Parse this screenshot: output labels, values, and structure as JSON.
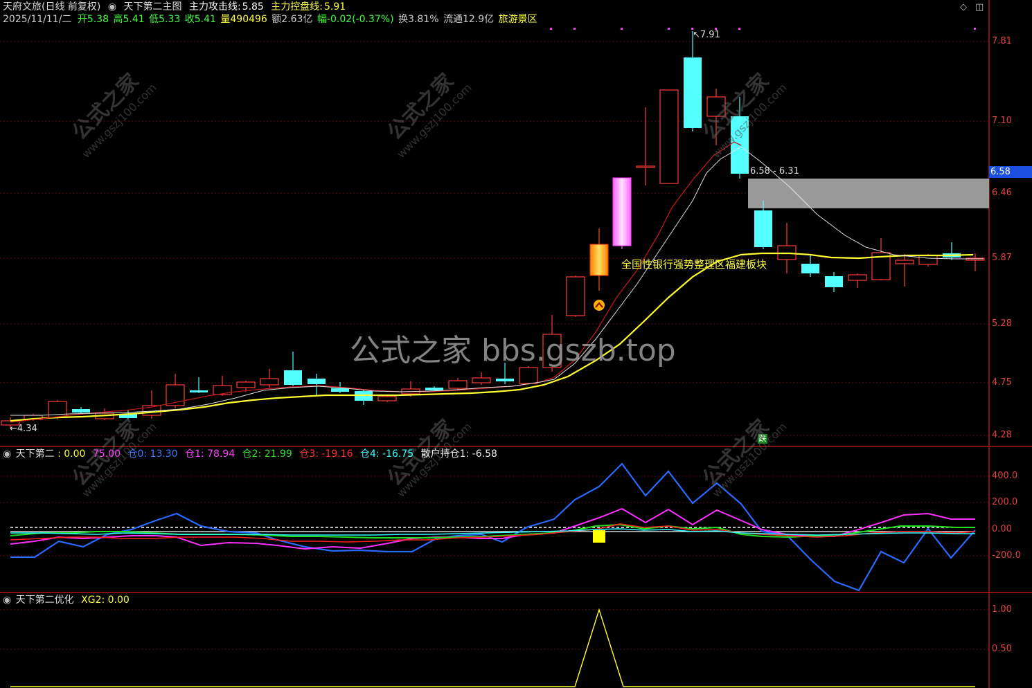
{
  "header": {
    "stock": "天府文旅(日线 前复权)",
    "indicator_main": "天下第二主图",
    "attack_line_label": "主力攻击线:",
    "attack_line_value": "5.85",
    "control_line_label": "主力控盘线:",
    "control_line_value": "5.91",
    "date": "2025/11/11/二",
    "open": "开5.38",
    "high": "高5.41",
    "low": "低5.33",
    "close": "收5.41",
    "volume": "量490496",
    "amount": "额2.63亿",
    "change": "幅-0.02(-0.37%)",
    "turnover": "换3.81%",
    "float": "流通12.9亿",
    "sector": "旅游景区"
  },
  "main_chart": {
    "y_axis": [
      "7.81",
      "7.10",
      "6.46",
      "5.87",
      "5.28",
      "4.75",
      "4.28"
    ],
    "current_price": "6.58",
    "high_annot": "7.91",
    "low_annot": "4.34",
    "zone_label": "6.58 - 6.31",
    "news": "全国性银行强势整理区福建板块",
    "signal_die": "跌"
  },
  "pane2": {
    "title": "天下第二",
    "v0": ": 0.00",
    "v1": "75.00",
    "cang0": "仓0: 13.30",
    "cang1": "仓1: 78.94",
    "cang2": "仓2: 21.99",
    "cang3": "仓3: -19.16",
    "cang4": "仓4: -16.75",
    "retail": "散户持仓1: -6.58",
    "y_axis": [
      "400.0",
      "200.0",
      "0.00",
      "-200.0"
    ]
  },
  "pane3": {
    "title": "天下第二优化",
    "xg2": "XG2: 0.00",
    "y_axis": [
      "1.00",
      "0.50"
    ]
  },
  "watermark": {
    "main": "公式之家 bbs.gszb.top",
    "diag": "公式之家",
    "url": "www.gszj100.com"
  },
  "controls": {
    "diamond": "◇",
    "window": "◫"
  },
  "colors": {
    "up": "#ff3c3c",
    "down": "#54ffff",
    "ma_yellow": "#ffff40",
    "ma_red": "#c01818"
  }
}
